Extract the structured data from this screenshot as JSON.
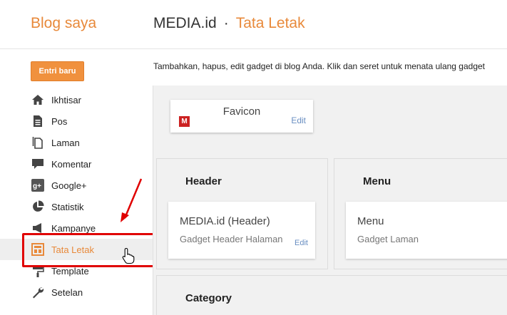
{
  "header": {
    "brand": "Blog saya",
    "site_name": "MEDIA.id",
    "separator": "·",
    "page_title": "Tata Letak"
  },
  "sidebar": {
    "new_post_label": "Entri baru",
    "items": [
      {
        "label": "Ikhtisar",
        "icon": "home-icon"
      },
      {
        "label": "Pos",
        "icon": "document-icon"
      },
      {
        "label": "Laman",
        "icon": "pages-icon"
      },
      {
        "label": "Komentar",
        "icon": "comment-icon"
      },
      {
        "label": "Google+",
        "icon": "google-plus-icon"
      },
      {
        "label": "Statistik",
        "icon": "pie-chart-icon"
      },
      {
        "label": "Kampanye",
        "icon": "campaign-icon"
      },
      {
        "label": "Tata Letak",
        "icon": "layout-icon",
        "active": true
      },
      {
        "label": "Template",
        "icon": "paint-roller-icon"
      },
      {
        "label": "Setelan",
        "icon": "wrench-icon"
      }
    ]
  },
  "main": {
    "description": "Tambahkan, hapus, edit gadget di blog Anda. Klik dan seret untuk menata ulang gadget",
    "favicon": {
      "title": "Favicon",
      "icon_letter": "M",
      "edit_label": "Edit"
    },
    "sections": {
      "header": {
        "title": "Header",
        "gadget": {
          "name": "MEDIA.id (Header)",
          "subtitle": "Gadget Header Halaman",
          "edit_label": "Edit"
        }
      },
      "menu": {
        "title": "Menu",
        "gadget": {
          "name": "Menu",
          "subtitle": "Gadget Laman"
        }
      },
      "category": {
        "title": "Category"
      }
    }
  },
  "colors": {
    "accent": "#e8893a",
    "button": "#f0913e",
    "link": "#6a8fc2",
    "annotation": "#e00000"
  }
}
